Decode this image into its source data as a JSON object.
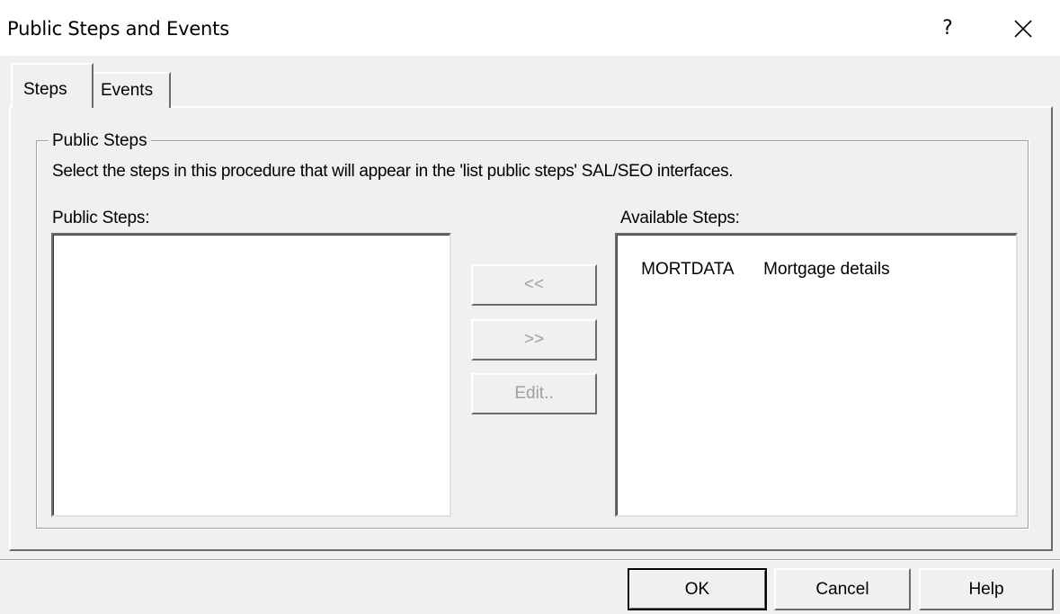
{
  "window": {
    "title": "Public Steps and Events",
    "help_glyph": "?",
    "close_icon": "close-icon"
  },
  "tabs": [
    {
      "label": "Steps",
      "selected": true
    },
    {
      "label": "Events",
      "selected": false
    }
  ],
  "public_steps_group": {
    "legend": "Public Steps",
    "description": "Select the steps in this procedure that will appear in the 'list public steps' SAL/SEO interfaces.",
    "public_label": "Public Steps:",
    "available_label": "Available Steps:",
    "public_items": [],
    "available_items": [
      {
        "code": "MORTDATA",
        "description": "Mortgage details"
      }
    ]
  },
  "transfer_buttons": {
    "move_left": "<<",
    "move_right": ">>",
    "edit": "Edit.."
  },
  "dialog_buttons": {
    "ok": "OK",
    "cancel": "Cancel",
    "help": "Help"
  }
}
